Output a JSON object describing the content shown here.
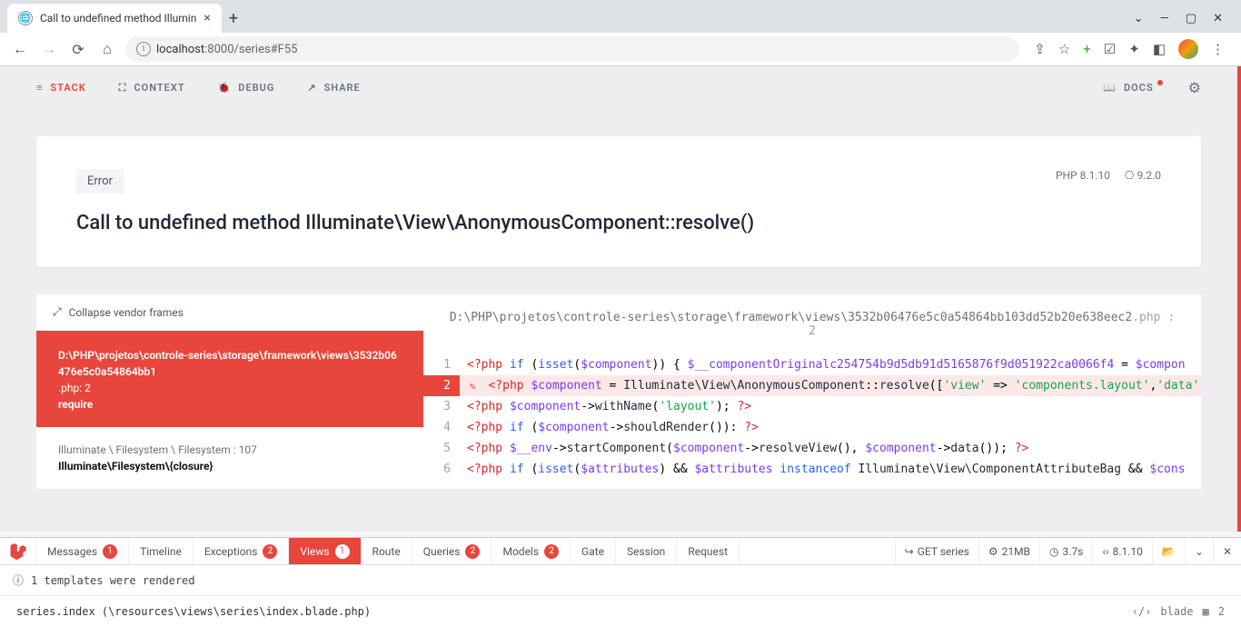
{
  "browser": {
    "tab_title": "Call to undefined method Illumin",
    "url_host": "localhost",
    "url_port": ":8000",
    "url_path": "/series#F55"
  },
  "nav": {
    "stack": "STACK",
    "context": "CONTEXT",
    "debug": "DEBUG",
    "share": "SHARE",
    "docs": "DOCS"
  },
  "error": {
    "badge": "Error",
    "title": "Call to undefined method Illuminate\\View\\AnonymousComponent::resolve()",
    "php_version": "PHP 8.1.10",
    "laravel_version": "9.2.0"
  },
  "frames": {
    "collapse_label": "Collapse vendor frames",
    "active": {
      "path": "D:\\PHP\\projetos\\controle-series\\storage\\framework\\views\\3532b06476e5c0a54864bb1",
      "ext": ".php",
      "line": ": 2",
      "method": "require"
    },
    "next": {
      "ns": "Illuminate \\ Filesystem \\ Filesystem : 107",
      "method": "Illuminate\\Filesystem\\{closure}"
    }
  },
  "filepath": {
    "dir": "D:\\PHP\\projetos\\controle-series\\storage\\framework\\views\\3532b06476e5c0a54864bb103dd52b20e638eec2",
    "ext": ".php",
    "line": " : 2"
  },
  "code": {
    "l1_num": "1",
    "l2_num": "2",
    "l3_num": "3",
    "l4_num": "4",
    "l5_num": "5",
    "l6_num": "6",
    "l1": {
      "a": "<?php ",
      "b": "if ",
      "c": "(",
      "d": "isset",
      "e": "(",
      "f": "$component",
      "g": ")) { ",
      "h": "$__componentOriginalc254754b9d5db91d5165876f9d051922ca0066f4",
      "i": " = ",
      "j": "$compon"
    },
    "l2": {
      "a": "<?php ",
      "b": "$component",
      "c": " = ",
      "d": "Illuminate\\View\\AnonymousComponent",
      "e": "::",
      "f": "resolve",
      "g": "([",
      "h": "'view'",
      "i": " => ",
      "j": "'components.layout'",
      "k": ",",
      "l": "'data'"
    },
    "l3": {
      "a": "<?php ",
      "b": "$component",
      "c": "->",
      "d": "withName",
      "e": "(",
      "f": "'layout'",
      "g": "); ",
      "h": "?>"
    },
    "l4": {
      "a": "<?php ",
      "b": "if ",
      "c": "(",
      "d": "$component",
      "e": "->",
      "f": "shouldRender",
      "g": "()): ",
      "h": "?>"
    },
    "l5": {
      "a": "<?php ",
      "b": "$__env",
      "c": "->",
      "d": "startComponent",
      "e": "(",
      "f": "$component",
      "g": "->",
      "h": "resolveView",
      "i": "(), ",
      "j": "$component",
      "k": "->",
      "l": "data",
      "m": "()); ",
      "n": "?>"
    },
    "l6": {
      "a": "<?php ",
      "b": "if ",
      "c": "(",
      "d": "isset",
      "e": "(",
      "f": "$attributes",
      "g": ") && ",
      "h": "$attributes",
      "i": " instanceof ",
      "j": "Illuminate\\View\\ComponentAttributeBag",
      "k": " && ",
      "l": "$cons"
    }
  },
  "debugbar": {
    "tabs": {
      "messages": "Messages",
      "messages_n": "1",
      "timeline": "Timeline",
      "exceptions": "Exceptions",
      "exceptions_n": "2",
      "views": "Views",
      "views_n": "1",
      "route": "Route",
      "queries": "Queries",
      "queries_n": "2",
      "models": "Models",
      "models_n": "2",
      "gate": "Gate",
      "session": "Session",
      "request": "Request"
    },
    "meta": {
      "method": "GET series",
      "memory": "21MB",
      "time": "3.7s",
      "php": "8.1.10"
    },
    "body": "1 templates were rendered",
    "detail": "series.index (\\resources\\views\\series\\index.blade.php)",
    "detail_lang": "blade",
    "detail_count": "2"
  }
}
